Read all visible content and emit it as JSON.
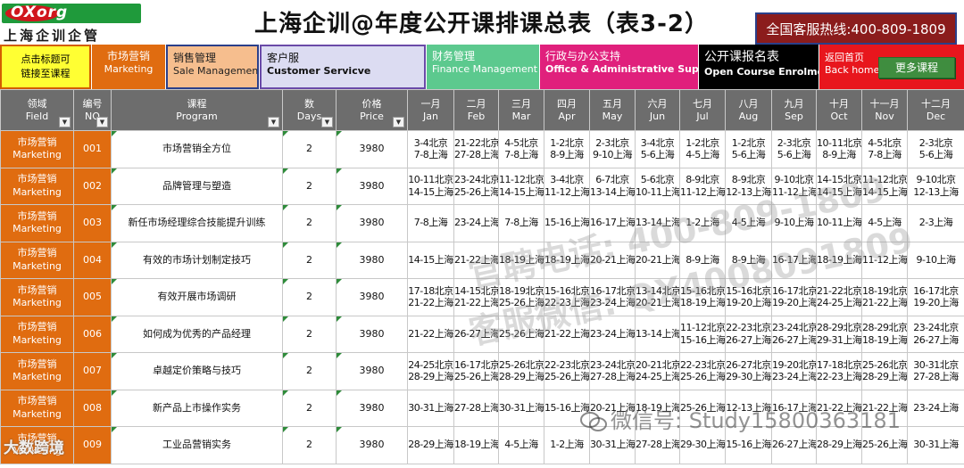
{
  "header": {
    "logo_word": "OXorg",
    "logo_sub": "上海企训企管",
    "title": "上海企训@年度公开课排课总表（表3-2）",
    "hotline": "全国客服热线:400-809-1809"
  },
  "nav": {
    "link_hint_1": "点击标题可",
    "link_hint_2": "链接至课程",
    "marketing_cn": "市场营销",
    "marketing_en": "Marketing",
    "sales_cn": "销售管理",
    "sales_en": "Sale Management",
    "cs_cn": "客户服",
    "cs_en": "Customer Servicve",
    "finance_cn": "财务管理",
    "finance_en": "Finance Management",
    "admin_cn": "行政与办公支持",
    "admin_en": "Office & Administrative Support",
    "enrol_cn": "公开课报名表",
    "enrol_en": "Open Course Enrolment Form",
    "home_cn": "返回首页",
    "home_en": "Back home",
    "more": "更多课程"
  },
  "table": {
    "columns": [
      {
        "cn": "领域",
        "en": "Field"
      },
      {
        "cn": "编号",
        "en": "NO"
      },
      {
        "cn": "课程",
        "en": "Program"
      },
      {
        "cn": "数",
        "en": "Days"
      },
      {
        "cn": "价格",
        "en": "Price"
      },
      {
        "cn": "一月",
        "en": "Jan"
      },
      {
        "cn": "二月",
        "en": "Feb"
      },
      {
        "cn": "三月",
        "en": "Mar"
      },
      {
        "cn": "四月",
        "en": "Apr"
      },
      {
        "cn": "五月",
        "en": "May"
      },
      {
        "cn": "六月",
        "en": "Jun"
      },
      {
        "cn": "七月",
        "en": "Jul"
      },
      {
        "cn": "八月",
        "en": "Aug"
      },
      {
        "cn": "九月",
        "en": "Sep"
      },
      {
        "cn": "十月",
        "en": "Oct"
      },
      {
        "cn": "十一月",
        "en": "Nov"
      },
      {
        "cn": "十二月",
        "en": "Dec"
      }
    ],
    "rows": [
      {
        "field_cn": "市场营销",
        "field_en": "Marketing",
        "no": "001",
        "program": "市场营销全方位",
        "days": "2",
        "price": "3980",
        "months": [
          [
            "3-4北京",
            "7-8上海"
          ],
          [
            "21-22北京",
            "27-28上海"
          ],
          [
            "4-5北京",
            "7-8上海"
          ],
          [
            "1-2北京",
            "8-9上海"
          ],
          [
            "2-3北京",
            "9-10上海"
          ],
          [
            "3-4北京",
            "5-6上海"
          ],
          [
            "1-2北京",
            "4-5上海"
          ],
          [
            "1-2北京",
            "5-6上海"
          ],
          [
            "2-3北京",
            "5-6上海"
          ],
          [
            "10-11北京",
            "8-9上海"
          ],
          [
            "4-5北京",
            "7-8上海"
          ],
          [
            "2-3北京",
            "5-6上海"
          ]
        ]
      },
      {
        "field_cn": "市场营销",
        "field_en": "Marketing",
        "no": "002",
        "program": "品牌管理与塑造",
        "days": "2",
        "price": "3980",
        "months": [
          [
            "10-11北京",
            "14-15上海"
          ],
          [
            "23-24北京",
            "25-26上海"
          ],
          [
            "11-12北京",
            "14-15上海"
          ],
          [
            "3-4北京",
            "11-12上海"
          ],
          [
            "6-7北京",
            "13-14上海"
          ],
          [
            "5-6北京",
            "10-11上海"
          ],
          [
            "8-9北京",
            "11-12上海"
          ],
          [
            "8-9北京",
            "12-13上海"
          ],
          [
            "9-10北京",
            "11-12上海"
          ],
          [
            "14-15北京",
            "14-15上海"
          ],
          [
            "11-12北京",
            "14-15上海"
          ],
          [
            "9-10北京",
            "12-13上海"
          ]
        ]
      },
      {
        "field_cn": "市场营销",
        "field_en": "Marketing",
        "no": "003",
        "program": "新任市场经理综合技能提升训练",
        "days": "2",
        "price": "3980",
        "months": [
          [
            "7-8上海"
          ],
          [
            "23-24上海"
          ],
          [
            "7-8上海"
          ],
          [
            "15-16上海"
          ],
          [
            "16-17上海"
          ],
          [
            "13-14上海"
          ],
          [
            "1-2上海"
          ],
          [
            "4-5上海"
          ],
          [
            "9-10上海"
          ],
          [
            "10-11上海"
          ],
          [
            "4-5上海"
          ],
          [
            "2-3上海"
          ]
        ]
      },
      {
        "field_cn": "市场营销",
        "field_en": "Marketing",
        "no": "004",
        "program": "有效的市场计划制定技巧",
        "days": "2",
        "price": "3980",
        "months": [
          [
            "14-15上海"
          ],
          [
            "21-22上海"
          ],
          [
            "18-19上海"
          ],
          [
            "18-19上海"
          ],
          [
            "20-21上海"
          ],
          [
            "20-21上海"
          ],
          [
            "8-9上海"
          ],
          [
            "8-9上海"
          ],
          [
            "16-17上海"
          ],
          [
            "18-19上海"
          ],
          [
            "11-12上海"
          ],
          [
            "9-10上海"
          ]
        ]
      },
      {
        "field_cn": "市场营销",
        "field_en": "Marketing",
        "no": "005",
        "program": "有效开展市场调研",
        "days": "2",
        "price": "3980",
        "months": [
          [
            "17-18北京",
            "21-22上海"
          ],
          [
            "14-15北京",
            "21-22上海"
          ],
          [
            "18-19北京",
            "25-26上海"
          ],
          [
            "15-16北京",
            "22-23上海"
          ],
          [
            "16-17北京",
            "23-24上海"
          ],
          [
            "13-14北京",
            "20-21上海"
          ],
          [
            "15-16北京",
            "18-19上海"
          ],
          [
            "15-16北京",
            "19-20上海"
          ],
          [
            "16-17北京",
            "19-20上海"
          ],
          [
            "21-22北京",
            "24-25上海"
          ],
          [
            "18-19北京",
            "21-22上海"
          ],
          [
            "16-17北京",
            "19-20上海"
          ]
        ]
      },
      {
        "field_cn": "市场营销",
        "field_en": "Marketing",
        "no": "006",
        "program": "如何成为优秀的产品经理",
        "days": "2",
        "price": "3980",
        "months": [
          [
            "21-22上海"
          ],
          [
            "26-27上海"
          ],
          [
            "25-26上海"
          ],
          [
            "21-22上海"
          ],
          [
            "23-24上海"
          ],
          [
            "13-14上海"
          ],
          [
            "11-12北京",
            "15-16上海"
          ],
          [
            "22-23北京",
            "26-27上海"
          ],
          [
            "23-24北京",
            "26-27上海"
          ],
          [
            "28-29北京",
            "29-31上海"
          ],
          [
            "28-29北京",
            "18-19上海"
          ],
          [
            "23-24北京",
            "26-27上海"
          ]
        ]
      },
      {
        "field_cn": "市场营销",
        "field_en": "Marketing",
        "no": "007",
        "program": "卓越定价策略与技巧",
        "days": "2",
        "price": "3980",
        "months": [
          [
            "24-25北京",
            "28-29上海"
          ],
          [
            "16-17北京",
            "25-26上海"
          ],
          [
            "25-26北京",
            "28-29上海"
          ],
          [
            "22-23北京",
            "25-26上海"
          ],
          [
            "23-24北京",
            "27-28上海"
          ],
          [
            "20-21北京",
            "24-25上海"
          ],
          [
            "22-23北京",
            "25-26上海"
          ],
          [
            "26-27北京",
            "29-30上海"
          ],
          [
            "19-20北京",
            "23-24上海"
          ],
          [
            "17-18北京",
            "22-23上海"
          ],
          [
            "25-26北京",
            "28-29上海"
          ],
          [
            "30-31北京",
            "27-28上海"
          ]
        ]
      },
      {
        "field_cn": "市场营销",
        "field_en": "Marketing",
        "no": "008",
        "program": "新产品上市操作实务",
        "days": "2",
        "price": "3980",
        "months": [
          [
            "30-31上海"
          ],
          [
            "27-28上海"
          ],
          [
            "30-31上海"
          ],
          [
            "15-16上海"
          ],
          [
            "20-21上海"
          ],
          [
            "18-19上海"
          ],
          [
            "25-26上海"
          ],
          [
            "12-13上海"
          ],
          [
            "16-17上海"
          ],
          [
            "21-22上海"
          ],
          [
            "21-22上海"
          ],
          [
            "23-24上海"
          ]
        ]
      },
      {
        "field_cn": "市场营销",
        "field_en": "Marketing",
        "no": "009",
        "program": "工业品营销实务",
        "days": "2",
        "price": "3980",
        "months": [
          [
            "28-29上海"
          ],
          [
            "18-19上海"
          ],
          [
            "4-5上海"
          ],
          [
            "1-2上海"
          ],
          [
            "30-31上海"
          ],
          [
            "27-28上海"
          ],
          [
            "29-30上海"
          ],
          [
            "15-16上海"
          ],
          [
            "26-27上海"
          ],
          [
            "28-29上海"
          ],
          [
            "25-26上海"
          ],
          [
            "30-31上海"
          ]
        ]
      }
    ]
  },
  "overlays": {
    "watermark_1": "官聘电话: 400-809-1809",
    "watermark_2": "客服微信: QX4008091809",
    "wechat_id": "微信号: Study15800363181",
    "brandmark": "大数跨境"
  }
}
